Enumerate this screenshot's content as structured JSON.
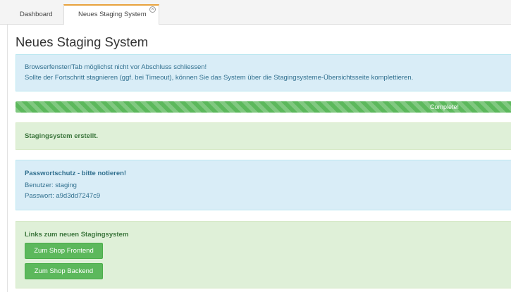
{
  "tabs": [
    {
      "label": "Dashboard"
    },
    {
      "label": "Neues Staging System",
      "close_icon": "×"
    }
  ],
  "page": {
    "title": "Neues Staging System"
  },
  "notice": {
    "line1": "Browserfenster/Tab möglichst nicht vor Abschluss schliessen!",
    "line2": "Sollte der Fortschritt stagnieren (ggf. bei Timeout), können Sie das System über die Stagingsysteme-Übersichtsseite komplettieren."
  },
  "progress": {
    "label": "Complete!",
    "percent": 100
  },
  "created": {
    "text": "Stagingsystem erstellt."
  },
  "password": {
    "heading": "Passwortschutz - bitte notieren!",
    "user_line": "Benutzer: staging",
    "password_line": "Passwort: a9d3dd7247c9"
  },
  "links": {
    "heading": "Links zum neuen Stagingsystem",
    "frontend_button": "Zum Shop Frontend",
    "backend_button": "Zum Shop Backend"
  },
  "colors": {
    "accent_tab": "#e8a33d",
    "info_bg": "#d9edf7",
    "success_bg": "#dff0d8",
    "button_green": "#5cb85c"
  }
}
